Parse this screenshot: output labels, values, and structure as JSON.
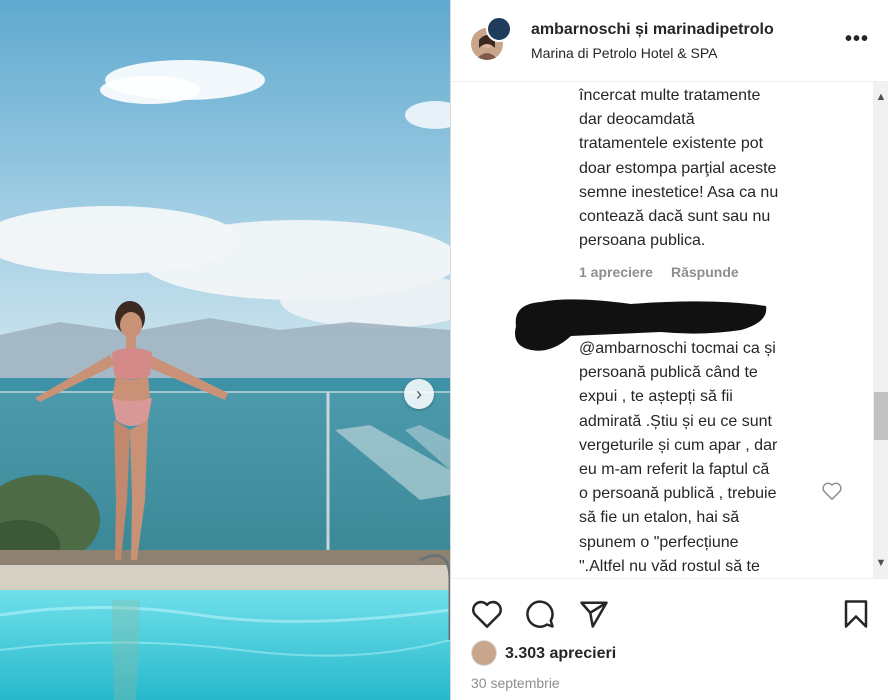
{
  "post": {
    "users": "ambarnoschi și marinadipetrolo",
    "location": "Marina di Petrolo Hotel & SPA"
  },
  "comments": [
    {
      "lines": [
        "încercat multe tratamente",
        "dar deocamdată",
        "tratamentele existente pot",
        "doar estompa parţial aceste",
        "semne inestetice! Asa ca nu",
        "contează dacă sunt sau nu",
        "persoana publica."
      ],
      "likes": "1 apreciere",
      "reply": "Răspunde"
    },
    {
      "mention": "@ambarnoschi",
      "first_line_rest": " tocmai ca și",
      "lines": [
        "persoană publică când te",
        "expui , te aștepți să fii",
        "admirată .Știu și eu ce sunt",
        "vergeturile și cum apar , dar",
        "eu m-am referit la faptul că",
        "o persoană publică , trebuie",
        "să fie un etalon, hai să",
        "spunem o \"perfecțiune",
        "\".Altfel nu văd rostul să te"
      ]
    }
  ],
  "footer": {
    "likes": "3.303 aprecieri",
    "date": "30 septembrie"
  },
  "icons": {
    "next": "chevron-right-icon",
    "more": "more-horizontal-icon",
    "like": "heart-icon",
    "comment": "comment-bubble-icon",
    "share": "paper-plane-icon",
    "save": "bookmark-icon"
  }
}
